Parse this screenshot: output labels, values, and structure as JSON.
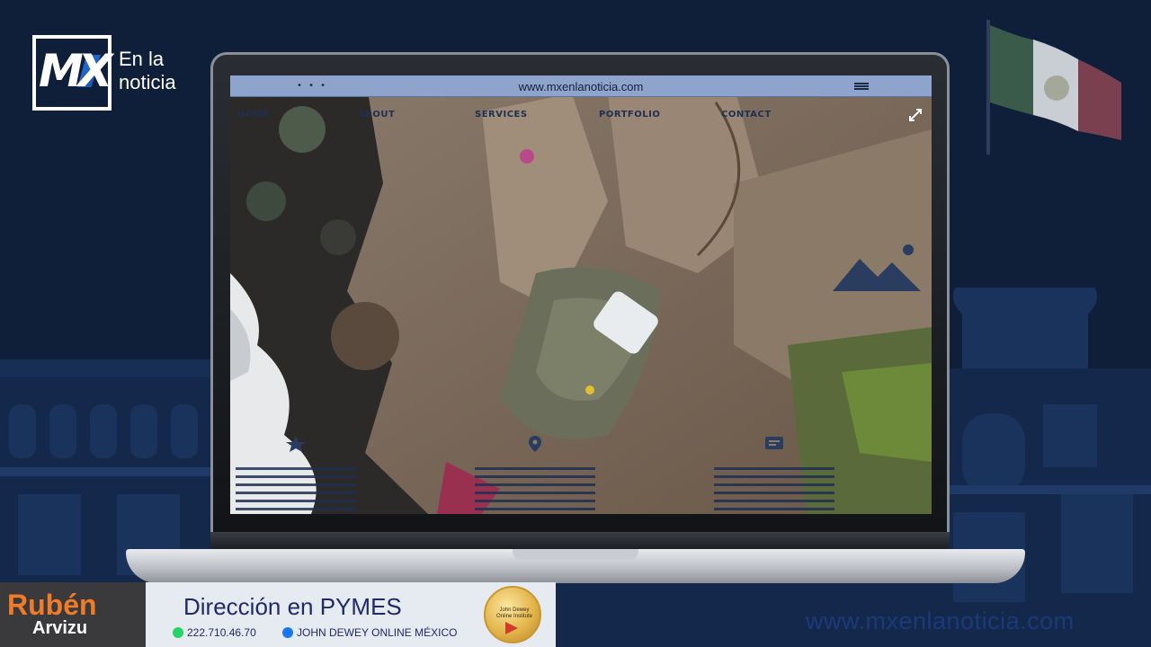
{
  "brand": {
    "logo_mark": "MX",
    "logo_text_line1": "En la",
    "logo_text_line2": "noticia"
  },
  "browser": {
    "dots": "• • •",
    "url": "www.mxenlanoticia.com"
  },
  "nav": {
    "items": [
      "HOME",
      "ABOUT",
      "SERVICES",
      "PORTFOLIO",
      "CONTACT"
    ]
  },
  "icons": {
    "expand": "expand-icon",
    "hero_image": "mountain-image-icon",
    "features": [
      "star-icon",
      "map-pin-icon",
      "chat-icon"
    ],
    "menu": "hamburger-menu-icon"
  },
  "footer_ad": {
    "first_name": "Rubén",
    "last_name": "Arvizu",
    "title": "Dirección en PYMES",
    "phone": "222.710.46.70",
    "facebook": "JOHN DEWEY ONLINE MÉXICO",
    "badge_text": "John Dewey Online Institute"
  },
  "watermark": "www.mxenlanoticia.com",
  "colors": {
    "background": "#0f1f3a",
    "browser_bar": "#8ea4cc",
    "accent_orange": "#f07c2a",
    "nav_text": "#1e2f52"
  }
}
